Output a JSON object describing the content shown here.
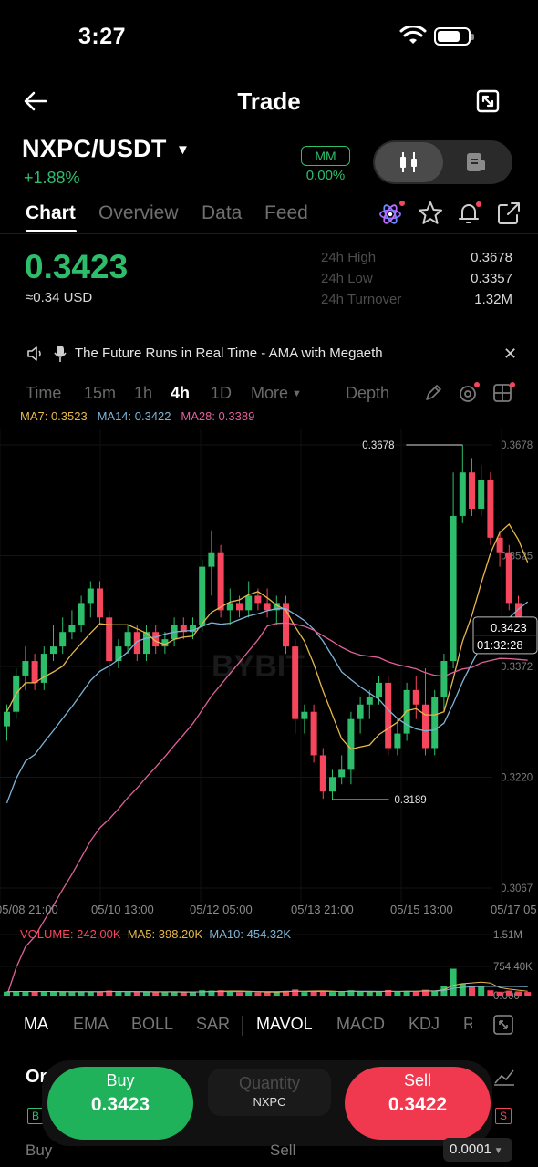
{
  "status_bar": {
    "time": "3:27"
  },
  "header": {
    "title": "Trade"
  },
  "pair": {
    "name": "NXPC/USDT",
    "change": "+1.88%",
    "mm_label": "MM",
    "mm_value": "0.00%"
  },
  "tabs": [
    "Chart",
    "Overview",
    "Data",
    "Feed"
  ],
  "price": {
    "last": "0.3423",
    "usd": "≈0.34 USD",
    "stats": [
      {
        "label": "24h High",
        "value": "0.3678"
      },
      {
        "label": "24h Low",
        "value": "0.3357"
      },
      {
        "label": "24h Turnover",
        "value": "1.32M"
      }
    ]
  },
  "announcement": {
    "text": "The Future Runs in Real Time -  AMA with Megaeth"
  },
  "intervals": [
    "Time",
    "15m",
    "1h",
    "4h",
    "1D",
    "More",
    "Depth"
  ],
  "ma_legend": {
    "ma7": "MA7: 0.3523",
    "ma14": "MA14: 0.3422",
    "ma28": "MA28: 0.3389"
  },
  "volume_legend": {
    "volume": "VOLUME: 242.00K",
    "ma5": "MA5: 398.20K",
    "ma10": "MA10: 454.32K"
  },
  "indicators": [
    "MA",
    "EMA",
    "BOLL",
    "SAR",
    "MAVOL",
    "MACD",
    "KDJ",
    "R"
  ],
  "trade": {
    "buy_label": "Buy",
    "buy_price": "0.3423",
    "sell_label": "Sell",
    "sell_price": "0.3422",
    "qty_label": "Quantity",
    "qty_unit": "NXPC"
  },
  "bottom": {
    "buy": "Buy",
    "sell": "Sell",
    "tick": "0.0001"
  },
  "colors": {
    "up": "#2ebd6b",
    "down": "#f6465d",
    "ma7": "#e6b84a",
    "ma14": "#7fb4d6",
    "ma28": "#e0609a"
  },
  "chart_data": {
    "type": "candlestick",
    "y_ticks": [
      "0.3678",
      "0.3525",
      "0.3372",
      "0.3220",
      "0.3067"
    ],
    "ylim": [
      0.3067,
      0.3678
    ],
    "x_ticks": [
      "05/08 21:00",
      "05/10 13:00",
      "05/12 05:00",
      "05/13 21:00",
      "05/15 13:00",
      "05/17 05"
    ],
    "high_marker": "0.3678",
    "low_marker": "0.3189",
    "current_price": "0.3423",
    "countdown": "01:32:28",
    "candles": [
      [
        0.329,
        0.331,
        0.327,
        0.332
      ],
      [
        0.331,
        0.336,
        0.33,
        0.337
      ],
      [
        0.336,
        0.338,
        0.334,
        0.34
      ],
      [
        0.338,
        0.335,
        0.334,
        0.339
      ],
      [
        0.335,
        0.339,
        0.334,
        0.34
      ],
      [
        0.339,
        0.34,
        0.338,
        0.343
      ],
      [
        0.34,
        0.342,
        0.339,
        0.344
      ],
      [
        0.342,
        0.343,
        0.341,
        0.345
      ],
      [
        0.343,
        0.346,
        0.342,
        0.347
      ],
      [
        0.346,
        0.348,
        0.344,
        0.349
      ],
      [
        0.348,
        0.344,
        0.343,
        0.349
      ],
      [
        0.344,
        0.338,
        0.336,
        0.345
      ],
      [
        0.338,
        0.34,
        0.337,
        0.341
      ],
      [
        0.34,
        0.342,
        0.339,
        0.343
      ],
      [
        0.342,
        0.339,
        0.338,
        0.343
      ],
      [
        0.339,
        0.342,
        0.338,
        0.343
      ],
      [
        0.342,
        0.34,
        0.339,
        0.343
      ],
      [
        0.34,
        0.341,
        0.339,
        0.342
      ],
      [
        0.341,
        0.343,
        0.34,
        0.344
      ],
      [
        0.343,
        0.342,
        0.341,
        0.344
      ],
      [
        0.342,
        0.343,
        0.341,
        0.344
      ],
      [
        0.343,
        0.351,
        0.342,
        0.352
      ],
      [
        0.351,
        0.353,
        0.347,
        0.356
      ],
      [
        0.353,
        0.345,
        0.344,
        0.354
      ],
      [
        0.345,
        0.346,
        0.343,
        0.348
      ],
      [
        0.346,
        0.345,
        0.344,
        0.347
      ],
      [
        0.345,
        0.347,
        0.344,
        0.349
      ],
      [
        0.347,
        0.346,
        0.345,
        0.348
      ],
      [
        0.346,
        0.345,
        0.344,
        0.348
      ],
      [
        0.345,
        0.346,
        0.343,
        0.347
      ],
      [
        0.346,
        0.34,
        0.339,
        0.347
      ],
      [
        0.34,
        0.33,
        0.328,
        0.341
      ],
      [
        0.33,
        0.331,
        0.328,
        0.332
      ],
      [
        0.331,
        0.325,
        0.324,
        0.332
      ],
      [
        0.325,
        0.32,
        0.319,
        0.326
      ],
      [
        0.32,
        0.322,
        0.3189,
        0.323
      ],
      [
        0.322,
        0.323,
        0.321,
        0.325
      ],
      [
        0.323,
        0.33,
        0.321,
        0.331
      ],
      [
        0.33,
        0.332,
        0.328,
        0.333
      ],
      [
        0.332,
        0.333,
        0.33,
        0.334
      ],
      [
        0.333,
        0.335,
        0.332,
        0.336
      ],
      [
        0.335,
        0.326,
        0.325,
        0.336
      ],
      [
        0.326,
        0.328,
        0.325,
        0.33
      ],
      [
        0.328,
        0.334,
        0.327,
        0.335
      ],
      [
        0.334,
        0.332,
        0.33,
        0.336
      ],
      [
        0.332,
        0.326,
        0.325,
        0.337
      ],
      [
        0.326,
        0.333,
        0.325,
        0.334
      ],
      [
        0.333,
        0.338,
        0.331,
        0.339
      ],
      [
        0.338,
        0.358,
        0.337,
        0.364
      ],
      [
        0.358,
        0.364,
        0.357,
        0.3678
      ],
      [
        0.364,
        0.359,
        0.358,
        0.366
      ],
      [
        0.359,
        0.363,
        0.358,
        0.365
      ],
      [
        0.363,
        0.355,
        0.354,
        0.364
      ],
      [
        0.355,
        0.353,
        0.351,
        0.356
      ],
      [
        0.353,
        0.346,
        0.345,
        0.354
      ],
      [
        0.346,
        0.343,
        0.341,
        0.347
      ],
      [
        0.343,
        0.3423,
        0.34,
        0.344
      ]
    ],
    "volume_ylim": [
      0,
      1510000
    ],
    "volume_ticks": [
      "1.51M",
      "754.40K",
      "0.000"
    ]
  }
}
